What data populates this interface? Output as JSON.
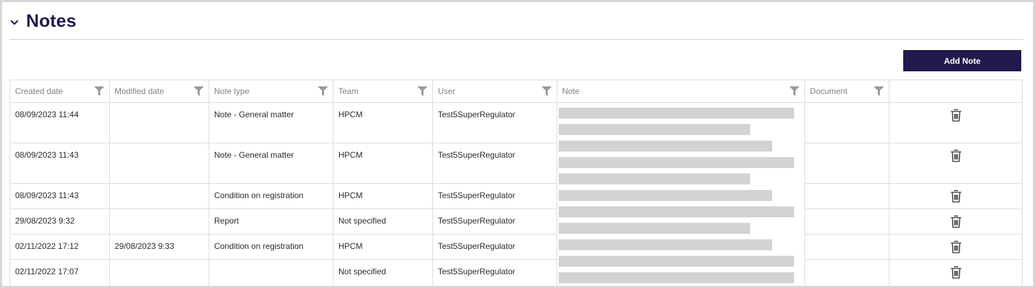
{
  "section": {
    "title": "Notes"
  },
  "actions": {
    "add_note_label": "Add Note"
  },
  "table": {
    "columns": [
      "Created date",
      "Modified date",
      "Note type",
      "Team",
      "User",
      "Note",
      "Document",
      ""
    ],
    "rows": [
      {
        "created": "08/09/2023 11:44",
        "modified": "",
        "note_type": "Note - General matter",
        "team": "HPCM",
        "user": "Test5SuperRegulator",
        "note": "",
        "document": ""
      },
      {
        "created": "08/09/2023 11:43",
        "modified": "",
        "note_type": "Note - General matter",
        "team": "HPCM",
        "user": "Test5SuperRegulator",
        "note": "",
        "document": ""
      },
      {
        "created": "08/09/2023 11:43",
        "modified": "",
        "note_type": "Condition on registration",
        "team": "HPCM",
        "user": "Test5SuperRegulator",
        "note": "",
        "document": ""
      },
      {
        "created": "29/08/2023 9:32",
        "modified": "",
        "note_type": "Report",
        "team": "Not specified",
        "user": "Test5SuperRegulator",
        "note": "",
        "document": ""
      },
      {
        "created": "02/11/2022 17:12",
        "modified": "29/08/2023 9:33",
        "note_type": "Condition on registration",
        "team": "HPCM",
        "user": "Test5SuperRegulator",
        "note": "",
        "document": ""
      },
      {
        "created": "02/11/2022 17:07",
        "modified": "",
        "note_type": "",
        "team": "Not specified",
        "user": "Test5SuperRegulator",
        "note": "",
        "document": ""
      }
    ]
  },
  "icons": {
    "collapse": "chevron-down-icon",
    "filter": "filter-icon",
    "delete": "trash-icon"
  },
  "colors": {
    "title": "#1f1a4d",
    "button": "#211a4d",
    "redaction": "#d3d3d3"
  }
}
